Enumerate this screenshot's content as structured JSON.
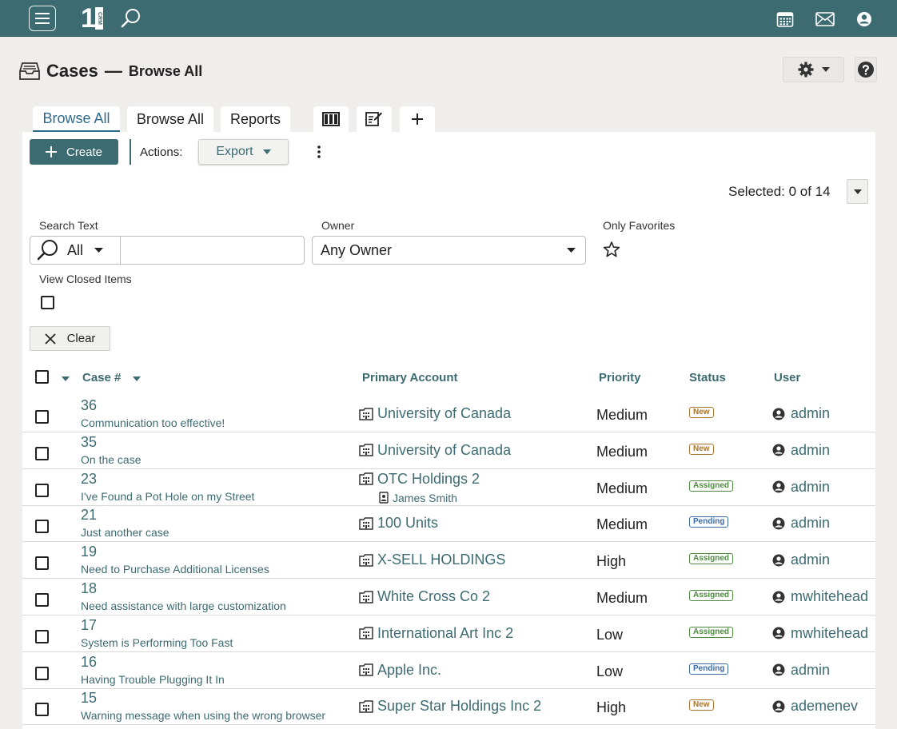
{
  "topbar": {
    "logo_text": "1",
    "logo_badge": "CRM",
    "icons": [
      "hamburger-menu-icon",
      "search-icon",
      "calendar-icon",
      "mail-icon",
      "user-circle-icon"
    ]
  },
  "header": {
    "title": "Cases",
    "dash": "—",
    "subtitle": "Browse All"
  },
  "tabs": [
    {
      "label": "Browse All",
      "active": true
    },
    {
      "label": "Browse All",
      "active": false
    },
    {
      "label": "Reports",
      "active": false
    }
  ],
  "toolbar": {
    "create_label": "Create",
    "actions_label": "Actions:",
    "export_label": "Export"
  },
  "selection": {
    "text": "Selected: 0 of 14"
  },
  "filters": {
    "search_text_label": "Search Text",
    "search_scope": "All",
    "search_value": "",
    "owner_label": "Owner",
    "owner_value": "Any Owner",
    "favorites_label": "Only Favorites",
    "view_closed_label": "View Closed Items",
    "clear_label": "Clear"
  },
  "table": {
    "columns": {
      "case_num": "Case #",
      "account": "Primary Account",
      "priority": "Priority",
      "status": "Status",
      "user": "User"
    },
    "rows": [
      {
        "num": "36",
        "subject": "Communication too effective!",
        "account": "University of Canada",
        "contact": "",
        "priority": "Medium",
        "status": "New",
        "user": "admin"
      },
      {
        "num": "35",
        "subject": "On the case",
        "account": "University of Canada",
        "contact": "",
        "priority": "Medium",
        "status": "New",
        "user": "admin"
      },
      {
        "num": "23",
        "subject": "I've Found a Pot Hole on my Street",
        "account": "OTC Holdings 2",
        "contact": "James Smith",
        "priority": "Medium",
        "status": "Assigned",
        "user": "admin"
      },
      {
        "num": "21",
        "subject": "Just another case",
        "account": "100 Units",
        "contact": "",
        "priority": "Medium",
        "status": "Pending",
        "user": "admin"
      },
      {
        "num": "19",
        "subject": "Need to Purchase Additional Licenses",
        "account": "X-SELL HOLDINGS",
        "contact": "",
        "priority": "High",
        "status": "Assigned",
        "user": "admin"
      },
      {
        "num": "18",
        "subject": "Need assistance with large customization",
        "account": "White Cross Co 2",
        "contact": "",
        "priority": "Medium",
        "status": "Assigned",
        "user": "mwhitehead"
      },
      {
        "num": "17",
        "subject": "System is Performing Too Fast",
        "account": "International Art Inc 2",
        "contact": "",
        "priority": "Low",
        "status": "Assigned",
        "user": "mwhitehead"
      },
      {
        "num": "16",
        "subject": "Having Trouble Plugging It In",
        "account": "Apple Inc.",
        "contact": "",
        "priority": "Low",
        "status": "Pending",
        "user": "admin"
      },
      {
        "num": "15",
        "subject": "Warning message when using the wrong browser",
        "account": "Super Star Holdings Inc 2",
        "contact": "",
        "priority": "High",
        "status": "New",
        "user": "ademenev"
      }
    ]
  },
  "colors": {
    "brand": "#3d6b72",
    "link": "#3d6b72",
    "tab_active": "#2e6a8e",
    "status_new": "#a9732b",
    "status_assigned": "#4d8a3e",
    "status_pending": "#3b6aa8"
  }
}
